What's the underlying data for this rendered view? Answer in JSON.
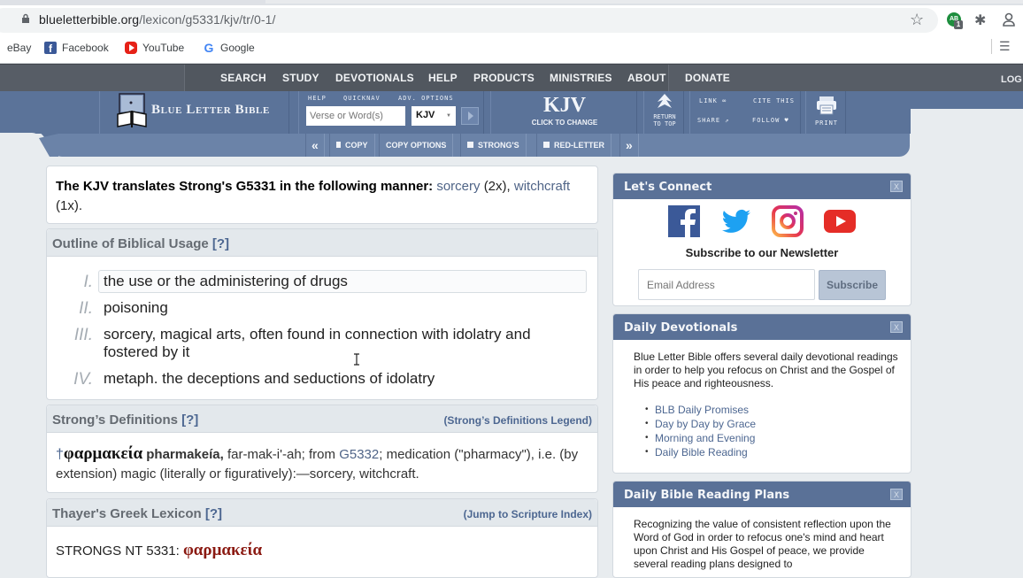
{
  "browser": {
    "url_domain": "blueletterbible.org",
    "url_path": "/lexicon/g5331/kjv/tr/0-1/",
    "extension_badge": "AB",
    "extension_count": "1",
    "bookmarks": [
      {
        "label": "eBay"
      },
      {
        "label": "Facebook"
      },
      {
        "label": "YouTube"
      },
      {
        "label": "Google"
      }
    ]
  },
  "topnav": {
    "items": [
      "SEARCH",
      "STUDY",
      "DEVOTIONALS",
      "HELP",
      "PRODUCTS",
      "MINISTRIES",
      "ABOUT",
      "DONATE"
    ],
    "login": "LOG"
  },
  "header": {
    "logo_text": "Blue Letter Bible",
    "labels": {
      "help": "HELP",
      "quicknav": "QUICKNAV",
      "adv_options": "ADV. OPTIONS"
    },
    "search_placeholder": "Verse or Word(s)",
    "version_selected": "KJV",
    "version_big": "KJV",
    "version_change": "CLICK TO CHANGE",
    "return_top": [
      "RETURN",
      "TO TOP"
    ],
    "link": "LINK",
    "cite": "CITE THIS",
    "share": "SHARE",
    "follow": "FOLLOW",
    "print": "PRINT"
  },
  "toolbar": {
    "copy": "COPY",
    "copy_options": "COPY OPTIONS",
    "strongs": "STRONG'S",
    "red_letter": "RED-LETTER"
  },
  "translation": {
    "lead": "The KJV translates Strong's G5331 in the following manner:",
    "items": [
      {
        "word": "sorcery",
        "count": "(2x)"
      },
      {
        "word": "witchcraft",
        "count": "(1x)"
      }
    ]
  },
  "outline": {
    "title": "Outline of Biblical Usage",
    "help": "[?]",
    "items": [
      {
        "num": "I.",
        "text": "the use or the administering of drugs"
      },
      {
        "num": "II.",
        "text": "poisoning"
      },
      {
        "num": "III.",
        "text": "sorcery, magical arts, often found in connection with idolatry and fostered by it"
      },
      {
        "num": "IV.",
        "text": "metaph. the deceptions and seductions of idolatry"
      }
    ]
  },
  "strongs": {
    "title": "Strong’s Definitions",
    "help": "[?]",
    "legend_link": "(Strong’s Definitions Legend)",
    "dagger": "†",
    "greek": "φαρμακεία",
    "translit": "pharmakeía,",
    "pron": "far-mak-i'-ah; from",
    "ref": "G5332",
    "def": "; medication (\"pharmacy\"), i.e. (by extension) magic (literally or figuratively):—sorcery, witchcraft."
  },
  "thayer": {
    "title": "Thayer's Greek Lexicon",
    "help": "[?]",
    "jump_link": "(Jump to Scripture Index)",
    "label": "STRONGS NT 5331:",
    "greek": "φαρμακεία"
  },
  "sidebar": {
    "connect": {
      "title": "Let's Connect",
      "close": "X",
      "social": [
        "facebook",
        "twitter",
        "instagram",
        "youtube"
      ],
      "newsletter": "Subscribe to our Newsletter",
      "email_placeholder": "Email Address",
      "subscribe": "Subscribe"
    },
    "devotionals": {
      "title": "Daily Devotionals",
      "close": "X",
      "text": "Blue Letter Bible offers several daily devotional readings in order to help you refocus on Christ and the Gospel of His peace and righteousness.",
      "links": [
        "BLB Daily Promises",
        "Day by Day by Grace",
        "Morning and Evening",
        "Daily Bible Reading"
      ]
    },
    "plans": {
      "title": "Daily Bible Reading Plans",
      "close": "X",
      "text": "Recognizing the value of consistent reflection upon the Word of God in order to refocus one's mind and heart upon Christ and His Gospel of peace, we provide several reading plans designed to"
    }
  }
}
